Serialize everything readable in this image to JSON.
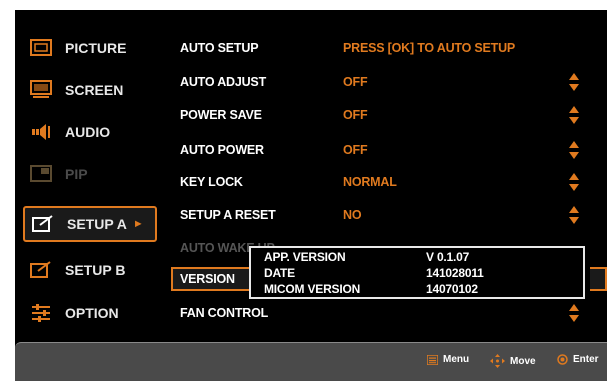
{
  "sidebar": {
    "items": [
      {
        "label": "PICTURE",
        "icon": "picture-icon",
        "state": "normal"
      },
      {
        "label": "SCREEN",
        "icon": "screen-icon",
        "state": "normal"
      },
      {
        "label": "AUDIO",
        "icon": "audio-icon",
        "state": "normal"
      },
      {
        "label": "PIP",
        "icon": "pip-icon",
        "state": "disabled"
      },
      {
        "label": "SETUP A",
        "icon": "setup-icon",
        "state": "selected"
      },
      {
        "label": "SETUP B",
        "icon": "setup-icon",
        "state": "normal"
      },
      {
        "label": "OPTION",
        "icon": "option-icon",
        "state": "normal"
      }
    ],
    "selected_arrow": "►"
  },
  "menu": {
    "rows": [
      {
        "label": "AUTO SETUP",
        "value": "PRESS [OK] TO AUTO SETUP"
      },
      {
        "label": "AUTO ADJUST",
        "value": "OFF"
      },
      {
        "label": "POWER SAVE",
        "value": "OFF"
      },
      {
        "label": "AUTO POWER",
        "value": "OFF"
      },
      {
        "label": "KEY LOCK",
        "value": "NORMAL"
      },
      {
        "label": "SETUP A RESET",
        "value": "NO"
      },
      {
        "label": "AUTO WAKE UP",
        "value": ""
      },
      {
        "label": "VERSION",
        "value": ""
      },
      {
        "label": "FAN CONTROL",
        "value": ""
      }
    ]
  },
  "version_popup": {
    "app_version_label": "APP. VERSION",
    "app_version_value": "V 0.1.07",
    "date_label": "DATE",
    "date_value": "141028011",
    "micom_label": "MICOM VERSION",
    "micom_value": "14070102"
  },
  "footer": {
    "menu_label": "Menu",
    "move_label": "Move",
    "enter_label": "Enter"
  },
  "colors": {
    "accent": "#e07a1f",
    "background": "#000000",
    "bar": "#4a4a4a"
  }
}
